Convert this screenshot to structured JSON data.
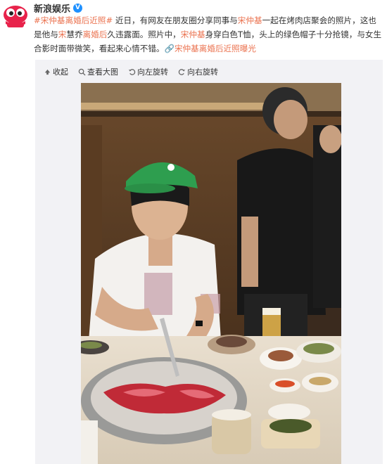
{
  "post": {
    "author_name": "新浪娱乐",
    "verified_badge": "V",
    "avatar_icon": "sina-entertainment-eye-logo",
    "content": {
      "hashtag_1": "#宋仲基离婚后近照#",
      "text_1": " 近日，有网友在朋友圈分享同事与",
      "mention_1": "宋仲基",
      "text_2": "一起在烤肉店聚会的照片，这也是他与",
      "mention_2": "宋",
      "text_3": "慧乔",
      "mention_3": "离婚后",
      "text_4": "久违露面。照片中，",
      "mention_4": "宋仲基",
      "text_5": "身穿白色T恤，头上的绿色帽子十分抢镜，与女生合影时面带微笑，看起来心情不错。",
      "link_label": "宋仲基离婚后近照",
      "link_suffix": "曝光"
    }
  },
  "media_toolbar": {
    "collapse": "收起",
    "view_large": "查看大图",
    "rotate_left": "向左旋转",
    "rotate_right": "向右旋转"
  },
  "colors": {
    "accent": "#eb7350",
    "verified": "#1e90ff",
    "cap_green": "#2e9e4f"
  }
}
